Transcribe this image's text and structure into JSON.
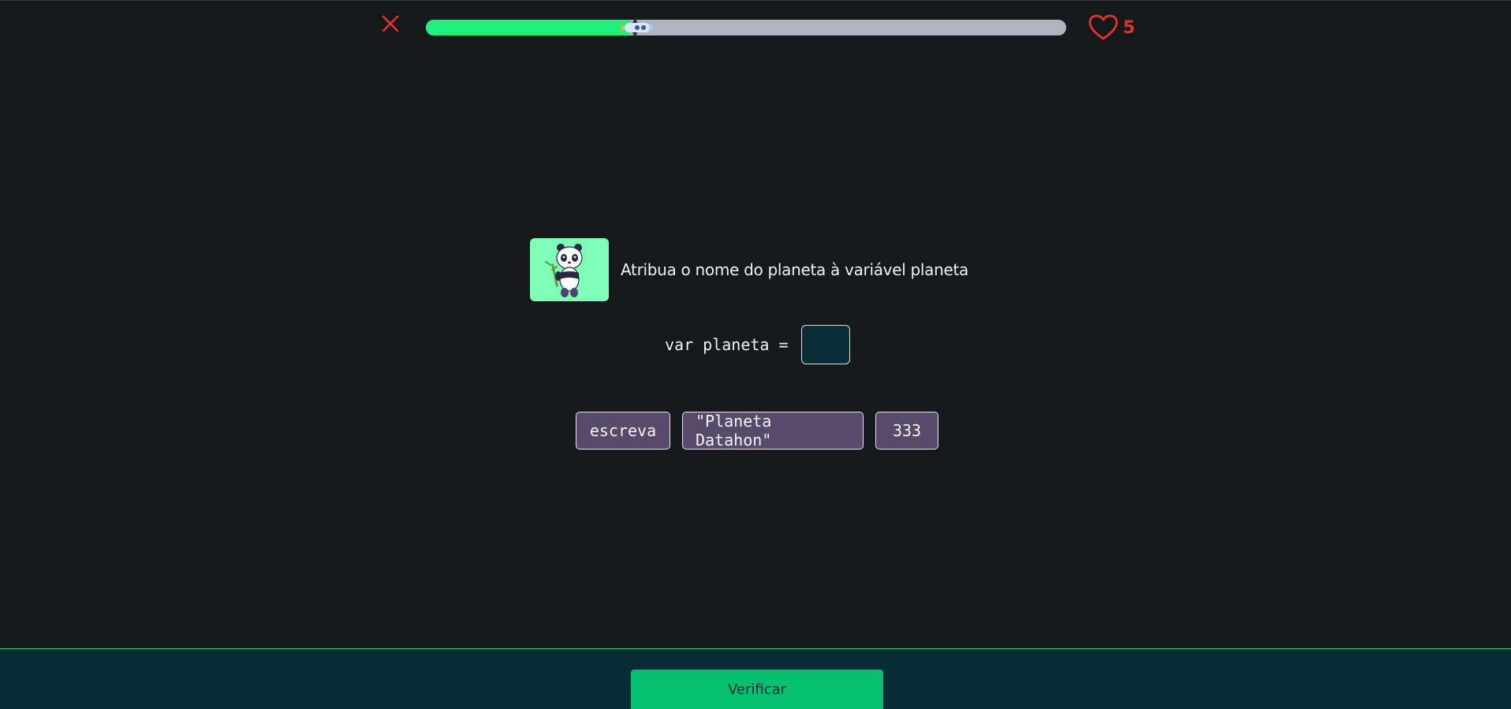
{
  "header": {
    "close_icon": "close-icon",
    "progress": 0.32,
    "progress_color": "#1ff07e",
    "track_color": "#b0b4bf",
    "progress_marker_icon": "rocket-icon",
    "lives_icon": "heart-icon",
    "lives_count": "5",
    "lives_color": "#e9302a"
  },
  "question": {
    "mascot_icon": "panda-with-bamboo-icon",
    "mascot_bg": "#7efdb7",
    "text": "Atribua o nome do planeta à variável planeta"
  },
  "code": {
    "prefix": "var planeta ="
  },
  "options": [
    {
      "label": "escreva"
    },
    {
      "label": "\"Planeta Datahon\""
    },
    {
      "label": "333"
    }
  ],
  "footer": {
    "verify_label": "Verificar",
    "button_color": "#04c06f"
  }
}
